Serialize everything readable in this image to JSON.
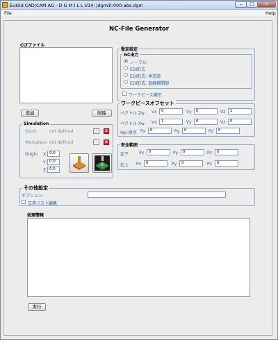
{
  "window": {
    "title": "Euklid CAD/CAM AG  -  D G M I L L  V14:  jdgmill-000-abs.dgm",
    "min_glyph": "–",
    "max_glyph": "□",
    "close_glyph": "✕"
  },
  "menu": {
    "file": "File",
    "help": "Help"
  },
  "page_title": "NC-File Generator",
  "clt": {
    "label": "CLTファイル",
    "add_button": "追加",
    "delete_button": "削除"
  },
  "simulation": {
    "title": "Simulation",
    "stock_label": "Stock",
    "stock_value": "not defined",
    "workpiece_label": "Workpiece",
    "workpiece_value": "not defined",
    "browse": "...",
    "remove": "x",
    "origin_label": "Origin",
    "x_label": "X",
    "x_value": "0.0",
    "y_label": "Y",
    "y_value": "0.0",
    "z_label": "Z",
    "z_value": "0.0"
  },
  "temp_settings": {
    "title": "暫定設定",
    "nc_output": {
      "title": "NC出力",
      "options": [
        "ノーマル",
        "EDI形式",
        "EDI形式: 早送部",
        "EDI形式: 直線補間部"
      ],
      "selected_index": 0
    },
    "workpiece_correction": "ワークピース補正"
  },
  "offset": {
    "title": "ワークピースオフセット",
    "vec_zw": {
      "label": "ベクトル Zw",
      "vx_label": "Vx",
      "vx": "0",
      "vy_label": "Vy",
      "vy": "0",
      "vz_label": "Vz",
      "vz": "1"
    },
    "vec_xw": {
      "label": "ベクトル Xw",
      "vx_label": "Vx",
      "vx": "1",
      "vy_label": "Vy",
      "vy": "0",
      "vz_label": "Vz",
      "vz": "0"
    },
    "origin": {
      "label": "Wp-原点",
      "px_label": "Px",
      "px": "0",
      "py_label": "Py",
      "py": "0",
      "pz_label": "Pz",
      "pz": "0"
    }
  },
  "safety": {
    "title": "安全範囲",
    "lower": {
      "label": "左下",
      "px_label": "Px",
      "px": "0",
      "py_label": "Py",
      "py": "0",
      "pz_label": "Pz",
      "pz": "0"
    },
    "upper": {
      "label": "右上",
      "px_label": "Px",
      "px": "0",
      "py_label": "Py",
      "py": "0",
      "pz_label": "Pz",
      "pz": "0"
    }
  },
  "other": {
    "title": "その他設定",
    "option_label": "オプション",
    "option_value": "",
    "tool_list_edit": "工具リスト編集"
  },
  "process": {
    "title": "処理情報"
  },
  "execute_button": "実行"
}
